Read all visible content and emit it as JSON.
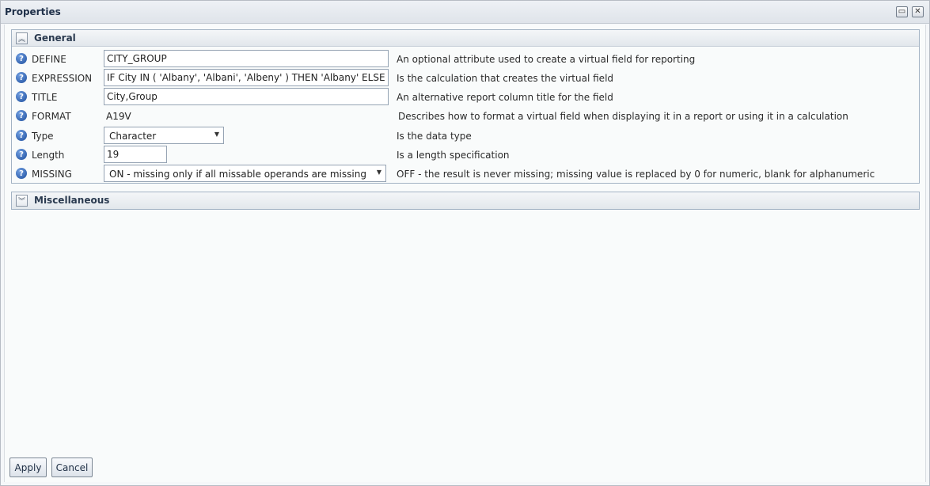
{
  "window": {
    "title": "Properties"
  },
  "panels": {
    "general": {
      "title": "General",
      "rows": [
        {
          "label": "DEFINE",
          "value": "CITY_GROUP",
          "description": "An optional attribute used to create a virtual field for reporting"
        },
        {
          "label": "EXPRESSION",
          "value": "IF City IN ( 'Albany', 'Albani', 'Albeny' ) THEN 'Albany' ELSE IF City",
          "description": "Is the calculation that creates the virtual field"
        },
        {
          "label": "TITLE",
          "value": "City,Group",
          "description": "An alternative report column title for the field"
        },
        {
          "label": "FORMAT",
          "value": "A19V",
          "description": "Describes how to format a virtual field when displaying it in a report or using it in a calculation"
        },
        {
          "label": "Type",
          "value": "Character",
          "description": "Is the data type"
        },
        {
          "label": "Length",
          "value": "19",
          "description": "Is a length specification"
        },
        {
          "label": "MISSING",
          "value": "ON - missing only if all missable operands are missing",
          "description": "OFF - the result is never missing; missing value is replaced by 0 for numeric, blank for alphanumeric"
        }
      ]
    },
    "misc": {
      "title": "Miscellaneous"
    }
  },
  "buttons": {
    "apply": "Apply",
    "cancel": "Cancel"
  },
  "icons": {
    "help": "question-circle-icon",
    "collapse": "chevron-double-up-icon",
    "expand": "chevron-double-down-icon",
    "restore": "restore-window-icon",
    "close": "close-icon"
  },
  "colors": {
    "accent": "#1e4f9e",
    "panel_border": "#a3b3c4",
    "title_text": "#1f3049"
  }
}
